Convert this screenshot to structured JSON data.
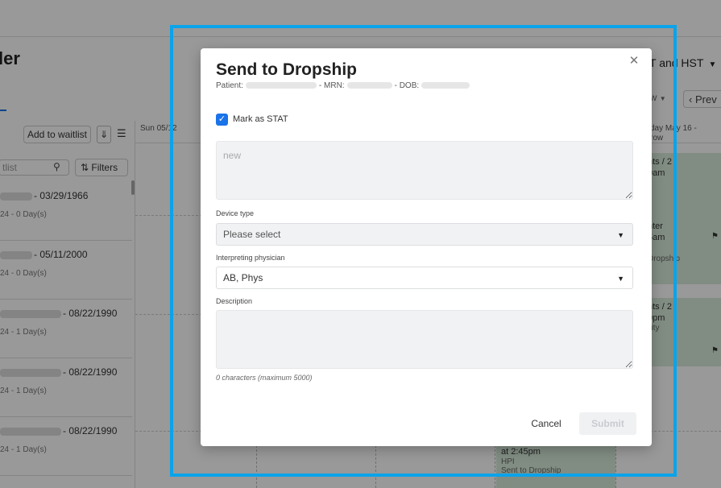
{
  "background": {
    "title": "ler",
    "timezone": "T and HST",
    "view_label": "ew",
    "prev_label": "Prev",
    "waitlist": {
      "add_button": "Add to waitlist",
      "search_placeholder": "tlist",
      "filters_label": "Filters",
      "rows": [
        {
          "dob": "- 03/29/1966",
          "sub": "24 - 0 Day(s)"
        },
        {
          "dob": "- 05/11/2000",
          "sub": "24 - 0 Day(s)"
        },
        {
          "dob": "- 08/22/1990",
          "sub": "24 - 1 Day(s)"
        },
        {
          "dob": "- 08/22/1990",
          "sub": "24 - 1 Day(s)"
        },
        {
          "dob": "- 08/22/1990",
          "sub": "24 - 1 Day(s)"
        }
      ]
    },
    "calendar": {
      "day0_header": "Sun 05/12",
      "day4_header_line1": "day May 16 -",
      "day4_header_line2": "row",
      "events": [
        {
          "title": "nts / 2",
          "time": "0am",
          "sub": ""
        },
        {
          "title": "nter",
          "time": "5am",
          "sub": "Dropship"
        },
        {
          "title": "nts / 2",
          "time": "0pm",
          "sub": "ility"
        },
        {
          "title": "at 2:45pm",
          "time": "",
          "sub": "HPI",
          "sub2": "Sent to Dropship"
        }
      ]
    }
  },
  "modal": {
    "title": "Send to Dropship",
    "patient_prefix": "Patient:",
    "mrn_label": "- MRN:",
    "dob_label": "- DOB:",
    "stat_label": "Mark as STAT",
    "stat_checked": true,
    "note_placeholder": "new",
    "device_type_label": "Device type",
    "device_type_value": "Please select",
    "physician_label": "Interpreting physician",
    "physician_value": "AB, Phys",
    "description_label": "Description",
    "char_count": "0 characters (maximum 5000)",
    "cancel_label": "Cancel",
    "submit_label": "Submit"
  },
  "colors": {
    "accent": "#1a73e8",
    "highlight_border": "#0ba3ea",
    "event_bg": "#d8ecda"
  }
}
